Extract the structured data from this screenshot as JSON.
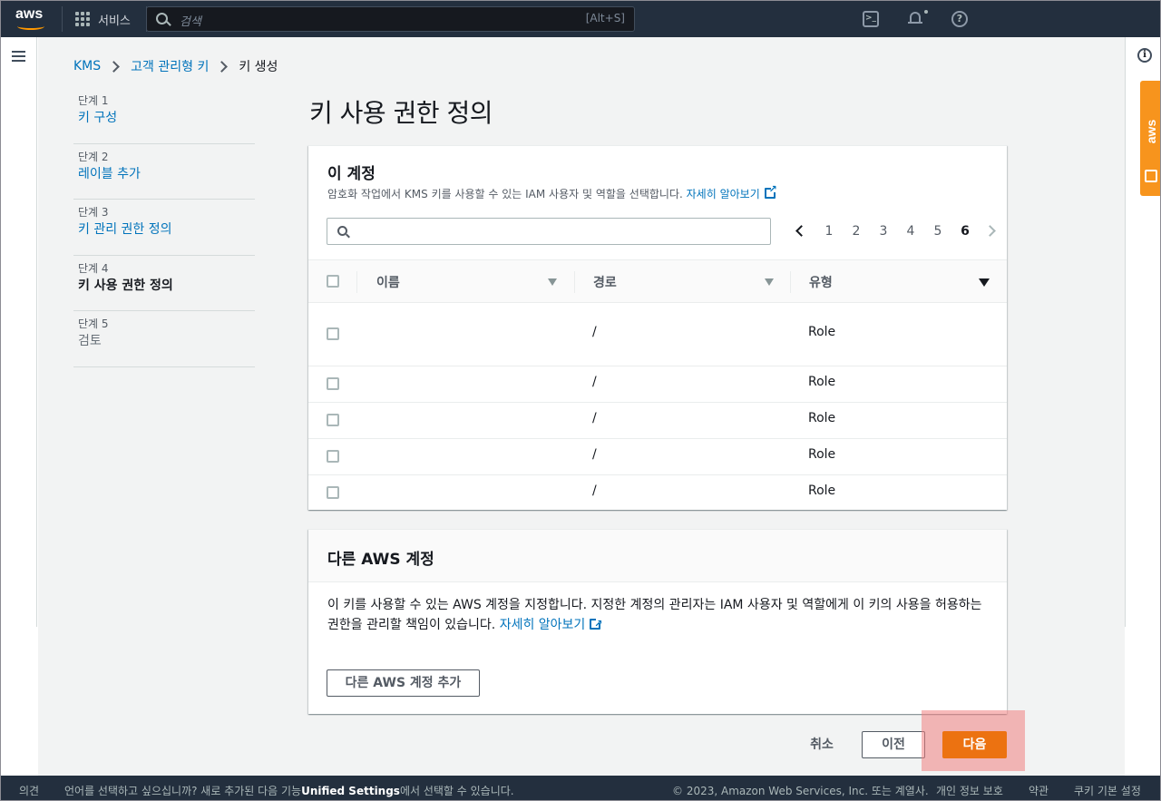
{
  "topnav": {
    "logo": "aws",
    "services_label": "서비스",
    "search_placeholder": "검색",
    "search_shortcut": "[Alt+S]",
    "cloudshell_glyph": ">_",
    "help_glyph": "?"
  },
  "right_rail": {
    "info_glyph": "i",
    "badge_text": "aws"
  },
  "breadcrumb": {
    "items": [
      "KMS",
      "고객 관리형 키",
      "키 생성"
    ]
  },
  "steps": [
    {
      "num": "단계 1",
      "label": "키 구성"
    },
    {
      "num": "단계 2",
      "label": "레이블 추가"
    },
    {
      "num": "단계 3",
      "label": "키 관리 권한 정의"
    },
    {
      "num": "단계 4",
      "label": "키 사용 권한 정의"
    },
    {
      "num": "단계 5",
      "label": "검토"
    }
  ],
  "page_title": "키 사용 권한 정의",
  "this_account": {
    "title": "이 계정",
    "description": "암호화 작업에서 KMS 키를 사용할 수 있는 IAM 사용자 및 역할을 선택합니다.",
    "learn_more": "자세히 알아보기",
    "pagination": {
      "pages": [
        "1",
        "2",
        "3",
        "4",
        "5",
        "6"
      ],
      "current": "6"
    },
    "columns": [
      "이름",
      "경로",
      "유형"
    ],
    "rows": [
      {
        "name": "",
        "path": "/",
        "type": "Role"
      },
      {
        "name": "",
        "path": "/",
        "type": "Role"
      },
      {
        "name": "",
        "path": "/",
        "type": "Role"
      },
      {
        "name": "",
        "path": "/",
        "type": "Role"
      },
      {
        "name": "",
        "path": "/",
        "type": "Role"
      }
    ]
  },
  "other_aws": {
    "title": "다른 AWS 계정",
    "description": "이 키를 사용할 수 있는 AWS 계정을 지정합니다. 지정한 계정의 관리자는 IAM 사용자 및 역할에게 이 키의 사용을 허용하는 권한을 관리할 책임이 있습니다.",
    "learn_more": "자세히 알아보기",
    "add_button": "다른 AWS 계정 추가"
  },
  "actions": {
    "cancel": "취소",
    "previous": "이전",
    "next": "다음"
  },
  "footer": {
    "feedback": "의견",
    "language_text": "언어를 선택하고 싶으십니까? 새로 추가된 다음 기능",
    "unified_settings": "Unified Settings",
    "language_suffix": "에서 선택할 수 있습니다.",
    "copyright": "© 2023, Amazon Web Services, Inc. 또는 계열사.",
    "privacy": "개인 정보 보호",
    "terms": "약관",
    "cookies": "쿠키 기본 설정"
  },
  "colors": {
    "primary_orange": "#ec7211",
    "link_blue": "#0073bb",
    "nav_dark": "#232f3e",
    "highlight": "#f08080"
  }
}
